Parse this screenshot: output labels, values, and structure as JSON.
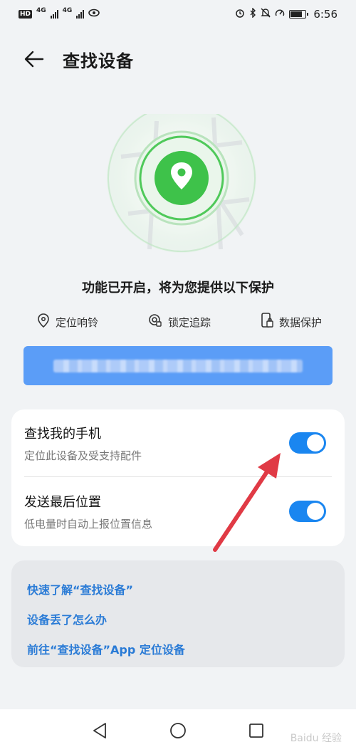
{
  "status_bar": {
    "hd_badge": "HD",
    "net1": "4G",
    "net2": "4G",
    "time": "6:56"
  },
  "header": {
    "title": "查找设备"
  },
  "protection": {
    "status_text": "功能已开启，将为您提供以下保护",
    "features": [
      {
        "label": "定位响铃",
        "icon": "location-icon"
      },
      {
        "label": "锁定追踪",
        "icon": "lock-track-icon"
      },
      {
        "label": "数据保护",
        "icon": "data-protect-icon"
      }
    ]
  },
  "settings": {
    "find_phone": {
      "title": "查找我的手机",
      "subtitle": "定位此设备及受支持配件",
      "enabled": true
    },
    "send_last_location": {
      "title": "发送最后位置",
      "subtitle": "低电量时自动上报位置信息",
      "enabled": true
    }
  },
  "links": [
    "快速了解“查找设备”",
    "设备丢了怎么办",
    "前往“查找设备”App 定位设备"
  ],
  "watermark": "Baidu 经验",
  "colors": {
    "accent_blue": "#1a86f0",
    "link_blue": "#2a7bd6",
    "green": "#3ec24a",
    "annotation_red": "#e03a45"
  }
}
